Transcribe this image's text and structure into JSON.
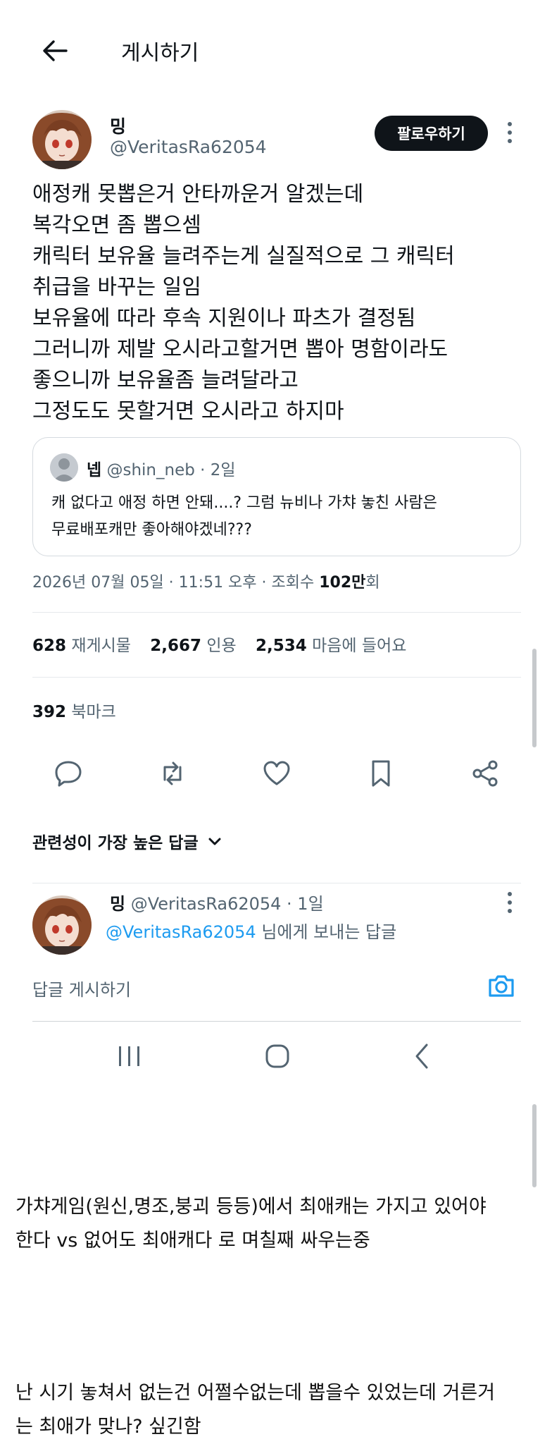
{
  "header": {
    "title": "게시하기"
  },
  "post": {
    "name": "밍",
    "handle": "@VeritasRa62054",
    "follow_label": "팔로우하기",
    "lines": [
      "애정캐 못뽑은거 안타까운거 알겠는데",
      "복각오면 좀 뽑으셈",
      "캐릭터 보유율 늘려주는게 실질적으로 그 캐릭터",
      "취급을 바꾸는 일임",
      "보유율에 따라 후속 지원이나 파츠가 결정됨",
      "그러니까 제발 오시라고할거면 뽑아 명함이라도",
      "좋으니까 보유율좀 늘려달라고",
      "그정도도 못할거면 오시라고 하지마"
    ],
    "quote": {
      "name": "넵",
      "meta": "@shin_neb · 2일",
      "lines": [
        "캐 없다고 애정 하면 안돼....? 그럼 뉴비나 가챠 놓친 사람은",
        "무료배포캐만 좋아해야겠네???"
      ]
    },
    "meta": {
      "datetime": "2026년 07월 05일 · 11:51 오후 · 조회수 ",
      "views": "102만",
      "views_suffix": "회"
    },
    "stats": {
      "reposts": "628",
      "reposts_label": "재게시물",
      "quotes": "2,667",
      "quotes_label": "인용",
      "likes": "2,534",
      "likes_label": "마음에 들어요"
    },
    "bookmarks": {
      "count": "392",
      "label": "북마크"
    }
  },
  "replies": {
    "sort_label": "관련성이 가장 높은 답글",
    "reply": {
      "name": "밍",
      "meta": "@VeritasRa62054 · 1일",
      "to_handle": "@VeritasRa62054",
      "to_suffix": " 님에게 보내는 답글"
    },
    "compose_placeholder": "답글 게시하기"
  },
  "caption": {
    "lines": [
      "가챠게임(원신,명조,붕괴 등등)에서 최애캐는 가지고 있어야",
      "한다 vs 없어도 최애캐다 로 며칠째 싸우는중"
    ],
    "lines2": [
      "난 시기 놓쳐서 없는건 어쩔수없는데 뽑을수 있었는데 거른거",
      "는 최애가 맞나? 싶긴함"
    ]
  },
  "colors": {
    "accent": "#1d9bf0",
    "text": "#0f1419",
    "muted": "#536471",
    "button": "#0f1419"
  },
  "icons": [
    "arrow-left-icon",
    "more-vertical-icon",
    "reply-icon",
    "repost-icon",
    "heart-icon",
    "bookmark-icon",
    "share-icon",
    "chevron-down-icon",
    "camera-icon",
    "recent-apps-icon",
    "home-icon",
    "back-nav-icon"
  ]
}
